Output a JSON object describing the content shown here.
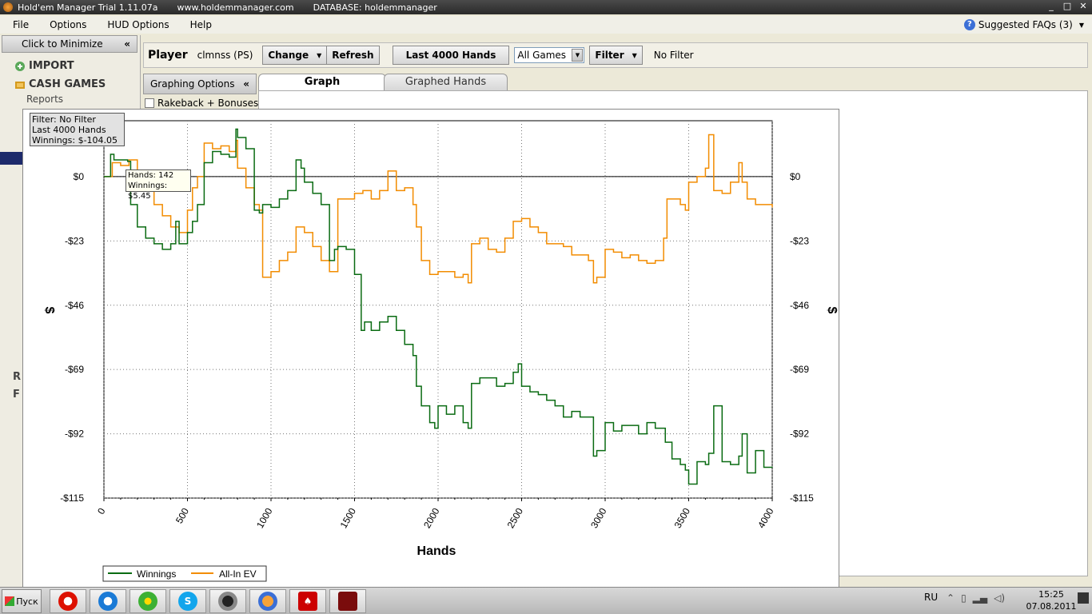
{
  "window": {
    "title": "Hold'em Manager Trial 1.11.07a",
    "website": "www.holdemmanager.com",
    "database": "DATABASE: holdemmanager"
  },
  "menu": {
    "items": [
      "File",
      "Options",
      "HUD Options",
      "Help"
    ],
    "faq": "Suggested FAQs (3)"
  },
  "sidebar": {
    "minimize_label": "Click to Minimize",
    "import_label": "IMPORT",
    "cash_games_label": "CASH GAMES",
    "reports_label": "Reports",
    "partial_r": "R",
    "partial_f": "F"
  },
  "player_bar": {
    "player_label": "Player",
    "player_name": "clmnss (PS)",
    "change_label": "Change",
    "refresh_label": "Refresh",
    "hands_label": "Last  4000 Hands",
    "games_value": "All Games",
    "filter_label": "Filter",
    "filter_status": "No Filter"
  },
  "graph_options": {
    "title": "Graphing Options",
    "rakeback_label": "Rakeback + Bonuses",
    "rakeback_checked": false
  },
  "tabs": [
    {
      "label": "Graph",
      "active": true
    },
    {
      "label": "Graphed Hands",
      "active": false
    }
  ],
  "info_box": {
    "line1": "Filter: No Filter",
    "line2": "Last  4000 Hands",
    "line3": "Winnings: $-104.05"
  },
  "tooltip": {
    "line1": "Hands: 142",
    "line2": "Winnings: $5.45"
  },
  "chart_data": {
    "type": "line",
    "xlabel": "Hands",
    "ylabel": "$",
    "xlim": [
      0,
      4000
    ],
    "ylim": [
      -115,
      20
    ],
    "x_ticks": [
      0,
      500,
      1000,
      1500,
      2000,
      2500,
      3000,
      3500,
      4000
    ],
    "y_ticks": [
      0,
      -23,
      -46,
      -69,
      -92,
      -115
    ],
    "y_tick_labels": [
      "$0",
      "-$23",
      "-$46",
      "-$69",
      "-$92",
      "-$115"
    ],
    "grid": true,
    "legend_position": "bottom-left",
    "series": [
      {
        "name": "Winnings",
        "color": "#0a6b12",
        "x": [
          0,
          40,
          60,
          142,
          160,
          200,
          250,
          300,
          350,
          400,
          430,
          450,
          500,
          530,
          560,
          600,
          650,
          700,
          750,
          790,
          800,
          850,
          900,
          930,
          950,
          1000,
          1050,
          1100,
          1150,
          1180,
          1200,
          1250,
          1300,
          1350,
          1380,
          1400,
          1450,
          1500,
          1540,
          1560,
          1600,
          1650,
          1700,
          1750,
          1800,
          1850,
          1870,
          1900,
          1950,
          1980,
          2000,
          2050,
          2100,
          2150,
          2180,
          2200,
          2250,
          2300,
          2350,
          2400,
          2450,
          2480,
          2500,
          2550,
          2600,
          2650,
          2700,
          2750,
          2800,
          2850,
          2900,
          2930,
          2950,
          3000,
          3050,
          3100,
          3150,
          3200,
          3250,
          3300,
          3350,
          3360,
          3400,
          3450,
          3480,
          3500,
          3550,
          3600,
          3620,
          3650,
          3700,
          3750,
          3800,
          3820,
          3850,
          3900,
          3950,
          4000
        ],
        "y": [
          0,
          8,
          6,
          5.45,
          -10,
          -18,
          -22,
          -24,
          -26,
          -24,
          -16,
          -24,
          -20,
          -16,
          -10,
          5,
          9,
          8,
          7,
          17,
          14,
          10,
          -12,
          -13,
          -10,
          -11,
          -8,
          -5,
          6,
          3,
          -2,
          -6,
          -10,
          -30,
          -26,
          -25,
          -26,
          -35,
          -55,
          -52,
          -55,
          -52,
          -50,
          -55,
          -60,
          -64,
          -75,
          -82,
          -88,
          -90,
          -82,
          -85,
          -82,
          -88,
          -90,
          -74,
          -72,
          -72,
          -75,
          -74,
          -70,
          -67,
          -75,
          -77,
          -78,
          -80,
          -82,
          -86,
          -84,
          -86,
          -86,
          -100,
          -98,
          -88,
          -91,
          -89,
          -89,
          -92,
          -88,
          -90,
          -90,
          -95,
          -101,
          -103,
          -105,
          -110,
          -102,
          -103,
          -99,
          -82,
          -102,
          -103,
          -100,
          -92,
          -106,
          -98,
          -104,
          -104.05
        ]
      },
      {
        "name": "All-In EV",
        "color": "#f28c00",
        "x": [
          0,
          50,
          100,
          150,
          200,
          250,
          300,
          350,
          400,
          450,
          500,
          530,
          560,
          600,
          650,
          700,
          750,
          790,
          800,
          850,
          900,
          930,
          950,
          1000,
          1050,
          1100,
          1150,
          1200,
          1250,
          1300,
          1350,
          1380,
          1400,
          1450,
          1500,
          1550,
          1600,
          1650,
          1700,
          1750,
          1800,
          1850,
          1870,
          1900,
          1950,
          2000,
          2050,
          2100,
          2150,
          2180,
          2200,
          2250,
          2300,
          2350,
          2400,
          2450,
          2500,
          2550,
          2600,
          2650,
          2700,
          2750,
          2800,
          2850,
          2900,
          2930,
          2950,
          3000,
          3050,
          3100,
          3150,
          3200,
          3250,
          3300,
          3350,
          3370,
          3400,
          3450,
          3480,
          3500,
          3550,
          3600,
          3620,
          3650,
          3700,
          3750,
          3800,
          3820,
          3850,
          3900,
          3950,
          4000
        ],
        "y": [
          0,
          5,
          4,
          6,
          0,
          -5,
          -10,
          -14,
          -18,
          -20,
          -12,
          -4,
          0,
          12,
          10,
          11,
          9,
          13,
          3,
          -4,
          -10,
          -12,
          -36,
          -34,
          -30,
          -27,
          -18,
          -20,
          -25,
          -30,
          -34,
          -34,
          -8,
          -8,
          -6,
          -5,
          -8,
          -5,
          2,
          -5,
          -4,
          -10,
          -18,
          -30,
          -35,
          -34,
          -34,
          -36,
          -35,
          -38,
          -24,
          -22,
          -26,
          -27,
          -22,
          -16,
          -15,
          -18,
          -20,
          -24,
          -24,
          -25,
          -28,
          -28,
          -30,
          -38,
          -36,
          -26,
          -27,
          -29,
          -28,
          -30,
          -31,
          -30,
          -22,
          -8,
          -8,
          -10,
          -12,
          -2,
          0,
          3,
          15,
          -5,
          -6,
          -2,
          5,
          -2,
          -8,
          -10,
          -10,
          -11
        ]
      }
    ]
  },
  "taskbar": {
    "start_label": "Пуск",
    "lang": "RU",
    "time": "15:25",
    "date": "07.08.2011"
  }
}
